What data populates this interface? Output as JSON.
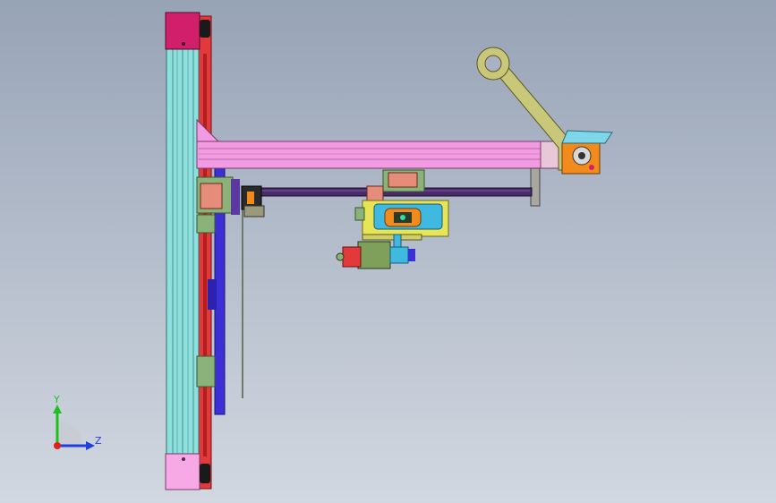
{
  "viewport": {
    "background_top": "#97a3b6",
    "background_bottom": "#d2d8e1"
  },
  "model": {
    "colors": {
      "column": "#8fe0dc",
      "column_edge": "#2f6f6f",
      "rail_red": "#e23a3a",
      "arm_pink": "#f29ae2",
      "cap_magenta": "#d21f6c",
      "cap_pink": "#f6a9e4",
      "bracket_olive": "#c9c77a",
      "screw_purple": "#4a2b6a",
      "carriage_yellow": "#e7e455",
      "carriage_blue": "#3fb9e0",
      "motor_orange": "#f28a1c",
      "motor_green": "#7fa05a",
      "blue_plate": "#3c2fd6",
      "green_block": "#8bb27a",
      "salmon_block": "#e58c7a"
    }
  },
  "triad": {
    "y_label": "Y",
    "z_label": "Z",
    "y_color": "#1fbf1f",
    "z_color": "#1f3fe0",
    "x_color": "#e01f1f"
  }
}
